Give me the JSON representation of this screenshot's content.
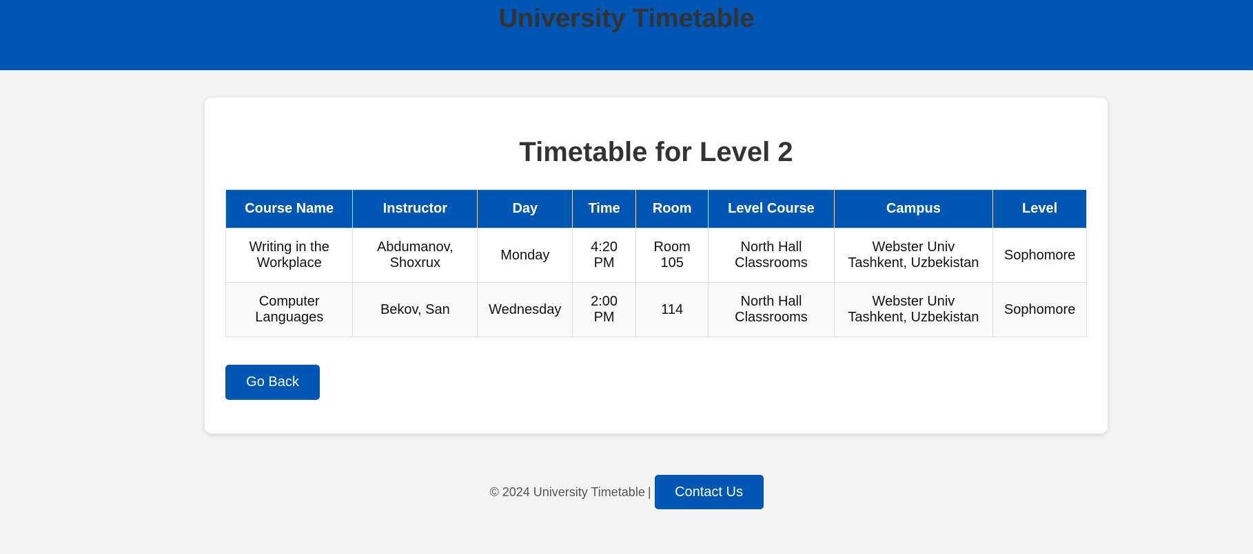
{
  "header": {
    "title": "University Timetable"
  },
  "main": {
    "title": "Timetable for Level 2",
    "table": {
      "headers": [
        "Course Name",
        "Instructor",
        "Day",
        "Time",
        "Room",
        "Level Course",
        "Campus",
        "Level"
      ],
      "rows": [
        [
          "Writing in the Workplace",
          "Abdumanov, Shoxrux",
          "Monday",
          "4:20 PM",
          "Room 105",
          "North Hall Classrooms",
          "Webster Univ Tashkent, Uzbekistan",
          "Sophomore"
        ],
        [
          "Computer Languages",
          "Bekov, San",
          "Wednesday",
          "2:00 PM",
          "114",
          "North Hall Classrooms",
          "Webster Univ Tashkent, Uzbekistan",
          "Sophomore"
        ]
      ]
    },
    "back_label": "Go Back"
  },
  "footer": {
    "copyright": "© 2024 University Timetable",
    "separator": "|",
    "contact_label": "Contact Us"
  },
  "colors": {
    "brand": "#0056b3",
    "background": "#f3f3f3"
  }
}
